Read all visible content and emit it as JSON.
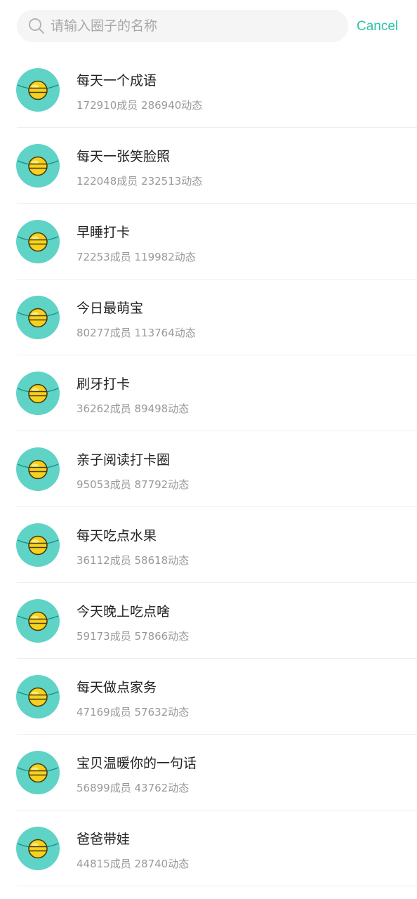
{
  "search": {
    "placeholder": "请输入圈子的名称",
    "value": "",
    "cancel_label": "Cancel"
  },
  "colors": {
    "accent": "#2ec4a6",
    "avatar_bg": "#5fd3c6",
    "coin": "#f6d21e",
    "placeholder": "#a8a8a8",
    "secondary_text": "#999999"
  },
  "circles": [
    {
      "name": "每天一个成语",
      "stats": "172910成员 286940动态"
    },
    {
      "name": "每天一张笑脸照",
      "stats": "122048成员 232513动态"
    },
    {
      "name": "早睡打卡",
      "stats": "72253成员 119982动态"
    },
    {
      "name": "今日最萌宝",
      "stats": "80277成员 113764动态"
    },
    {
      "name": "刷牙打卡",
      "stats": "36262成员 89498动态"
    },
    {
      "name": "亲子阅读打卡圈",
      "stats": "95053成员 87792动态"
    },
    {
      "name": "每天吃点水果",
      "stats": "36112成员 58618动态"
    },
    {
      "name": "今天晚上吃点啥",
      "stats": "59173成员 57866动态"
    },
    {
      "name": "每天做点家务",
      "stats": "47169成员 57632动态"
    },
    {
      "name": "宝贝温暖你的一句话",
      "stats": "56899成员 43762动态"
    },
    {
      "name": "爸爸带娃",
      "stats": "44815成员 28740动态"
    }
  ]
}
